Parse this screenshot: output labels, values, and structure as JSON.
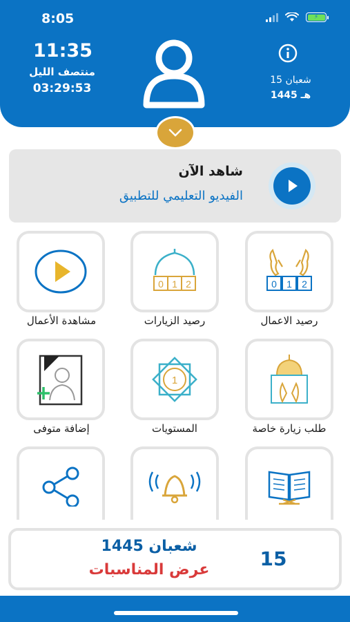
{
  "status_bar": {
    "time": "8:05"
  },
  "header": {
    "clock_time": "11:35",
    "clock_period": "منتصف الليل",
    "clock_remaining": "03:29:53",
    "hijri_day_month": "15 شعبان",
    "hijri_year": "1445 هـ"
  },
  "watch_banner": {
    "title": "شاهد الآن",
    "subtitle": "الفيديو التعليمي للتطبيق"
  },
  "grid": {
    "items": [
      {
        "label": "رصيد الاعمال",
        "icon": "prayer-hands-counter-icon"
      },
      {
        "label": "رصيد الزيارات",
        "icon": "mosque-counter-icon"
      },
      {
        "label": "مشاهدة الأعمال",
        "icon": "play-circle-icon"
      },
      {
        "label": "طلب زيارة خاصة",
        "icon": "shrine-hands-icon"
      },
      {
        "label": "المستويات",
        "icon": "levels-star-icon"
      },
      {
        "label": "إضافة متوفى",
        "icon": "deceased-portrait-icon"
      },
      {
        "label": "",
        "icon": "quran-book-icon"
      },
      {
        "label": "",
        "icon": "bell-icon"
      },
      {
        "label": "",
        "icon": "share-icon"
      }
    ],
    "levels_number": "1",
    "counter_digits": [
      "0",
      "1",
      "2"
    ]
  },
  "date_card": {
    "day": "15",
    "month_year": "شعبان 1445",
    "events_label": "عرض المناسبات"
  },
  "colors": {
    "primary_blue": "#0b73c4",
    "gold": "#d9a53a",
    "teal": "#3bb0c9",
    "red": "#d93a3a"
  }
}
